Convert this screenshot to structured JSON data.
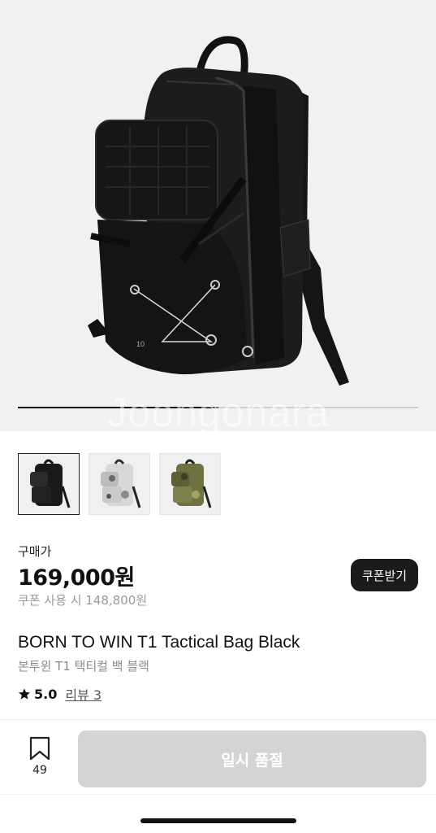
{
  "product": {
    "watermark": "Joongonara",
    "image_progress": 0.5,
    "gallery": [
      {
        "name": "black",
        "color": "#1a1a1a",
        "accent": "#2b2b2b"
      },
      {
        "name": "snow-camo",
        "color": "#d8d8d8",
        "accent": "#6b6b6b"
      },
      {
        "name": "green-camo",
        "color": "#6f7240",
        "accent": "#3c3d22"
      }
    ],
    "price_label": "구매가",
    "price": "169,000원",
    "coupon_price": "쿠폰 사용 시 148,800원",
    "coupon_button": "쿠폰받기",
    "title_en": "BORN TO WIN T1 Tactical Bag Black",
    "title_ko": "본투윈 T1 택티컬 백 블랙",
    "rating": "5.0",
    "review_link": "리뷰 3"
  },
  "bottom_bar": {
    "bookmark_count": "49",
    "action_button": "일시 품절"
  },
  "colors": {
    "hero_bg": "#f1f1f1",
    "button_dark": "#1b1b1b",
    "button_disabled": "#d4d4d4"
  }
}
